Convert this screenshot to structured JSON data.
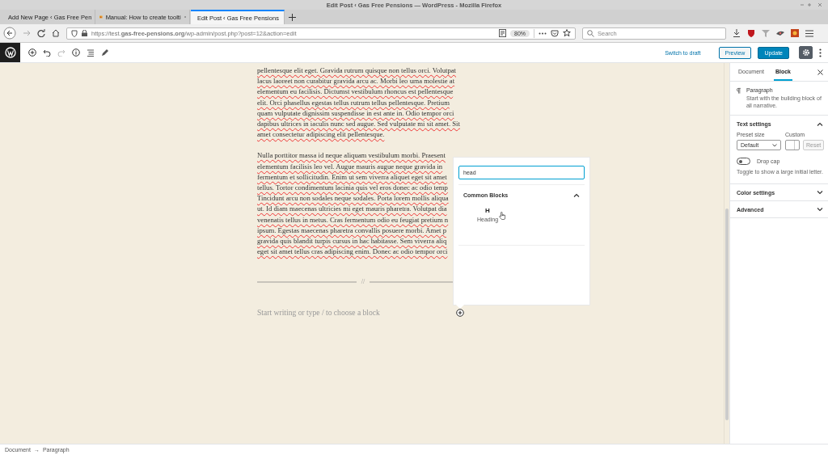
{
  "window": {
    "title": "Edit Post ‹ Gas Free Pensions — WordPress - Mozilla Firefox"
  },
  "browser_tabs": [
    {
      "label": "Add New Page ‹ Gas Free Pen",
      "selected": false
    },
    {
      "label": "Manual: How to create toolti",
      "selected": false
    },
    {
      "label": "Edit Post ‹ Gas Free Pensions",
      "selected": true
    }
  ],
  "address_bar": {
    "url": "https://test.**gas-free-pensions.org**/wp-admin/post.php?post=12&action=edit",
    "zoom": "80%"
  },
  "search": {
    "placeholder": "Search"
  },
  "toolbar": {
    "redo_disabled": true,
    "switch_link": "Switch to draft",
    "preview": "Preview",
    "update": "Update",
    "settings_selected": true
  },
  "editor": {
    "paragraphs": [
      [
        "pellentesque elit eget. Gravida rutrum quisque non tellus orci. Volutpat",
        "lacus laoreet non curabitur gravida arcu ac. Morbi leo urna molestie at",
        "elementum eu facilisis. Dictumst vestibulum rhoncus est pellentesque",
        "elit. Orci phasellus egestas tellus rutrum tellus pellentesque. Pretium",
        "quam vulputate dignissim suspendisse in est ante in. Odio tempor orci",
        "dapibus ultrices in iaculis nunc sed augue. Sed vulputate mi sit amet. Sit",
        "amet consectetur adipiscing elit pellentesque."
      ],
      [
        "Nulla porttitor massa id neque aliquam vestibulum morbi. Praesent",
        "elementum facilisis leo vel. Augue mauris augue neque gravida in",
        "fermentum et sollicitudin. Enim ut sem viverra aliquet eget sit amet",
        "tellus. Tortor condimentum lacinia quis vel eros donec ac odio temp",
        "Tincidunt arcu non sodales neque sodales. Porta lorem mollis aliqua",
        "ut. Id diam maecenas ultricies mi eget mauris pharetra. Volutpat dia",
        "venenatis tellus in metus. Cras fermentum odio eu feugiat pretium n",
        "ipsum. Egestas maecenas pharetra convallis posuere morbi. Amet p",
        "gravida quis blandit turpis cursus in hac habitasse. Sem viverra aliq",
        "eget sit amet tellus cras adipiscing enim. Donec ac odio tempor orci"
      ]
    ],
    "separator": "//",
    "placeholder": "Start writing or type / to choose a block"
  },
  "inserter": {
    "search_value": "head",
    "section": "Common Blocks",
    "expanded": true,
    "blocks": [
      {
        "icon": "H",
        "label": "Heading"
      }
    ]
  },
  "sidebar": {
    "tabs": [
      {
        "label": "Document",
        "selected": false
      },
      {
        "label": "Block",
        "selected": true
      }
    ],
    "block": {
      "name": "Paragraph",
      "description": "Start with the building block of all narrative."
    },
    "panels": [
      {
        "title": "Text settings",
        "expanded": true,
        "preset_label": "Preset size",
        "preset_value": "Default",
        "custom_label": "Custom",
        "reset": "Reset",
        "reset_disabled": true,
        "drop_cap": "Drop cap",
        "drop_cap_on": false,
        "help": "Toggle to show a large initial letter."
      },
      {
        "title": "Color settings",
        "expanded": false
      },
      {
        "title": "Advanced",
        "expanded": false
      }
    ]
  },
  "breadcrumb": [
    "Document",
    "Paragraph"
  ],
  "breadcrumb_separator": "→"
}
